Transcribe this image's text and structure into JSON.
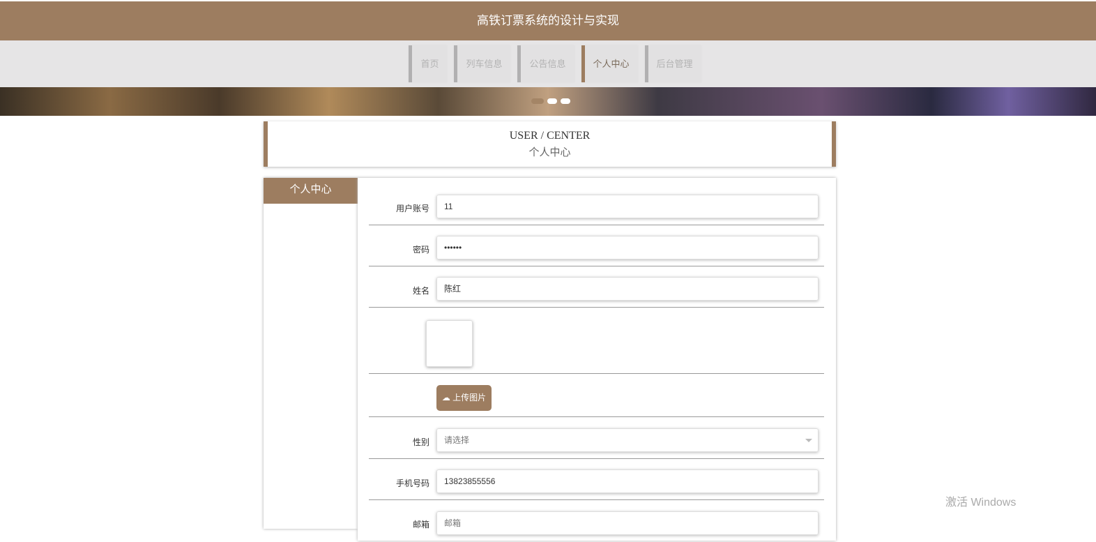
{
  "header": {
    "title": "高铁订票系统的设计与实现"
  },
  "nav": [
    {
      "label": "首页"
    },
    {
      "label": "列车信息"
    },
    {
      "label": "公告信息"
    },
    {
      "label": "个人中心"
    },
    {
      "label": "后台管理"
    }
  ],
  "page_title": {
    "en": "USER / CENTER",
    "cn": "个人中心"
  },
  "sidebar": {
    "heading": "个人中心"
  },
  "form": {
    "account_label": "用户账号",
    "account_value": "11",
    "password_label": "密码",
    "password_value": "••••••",
    "name_label": "姓名",
    "name_value": "陈红",
    "upload_label": "上传图片",
    "gender_label": "性别",
    "gender_placeholder": "请选择",
    "phone_label": "手机号码",
    "phone_value": "13823855556",
    "email_label": "邮箱",
    "email_placeholder": "邮箱"
  },
  "watermark": "激活 Windows"
}
